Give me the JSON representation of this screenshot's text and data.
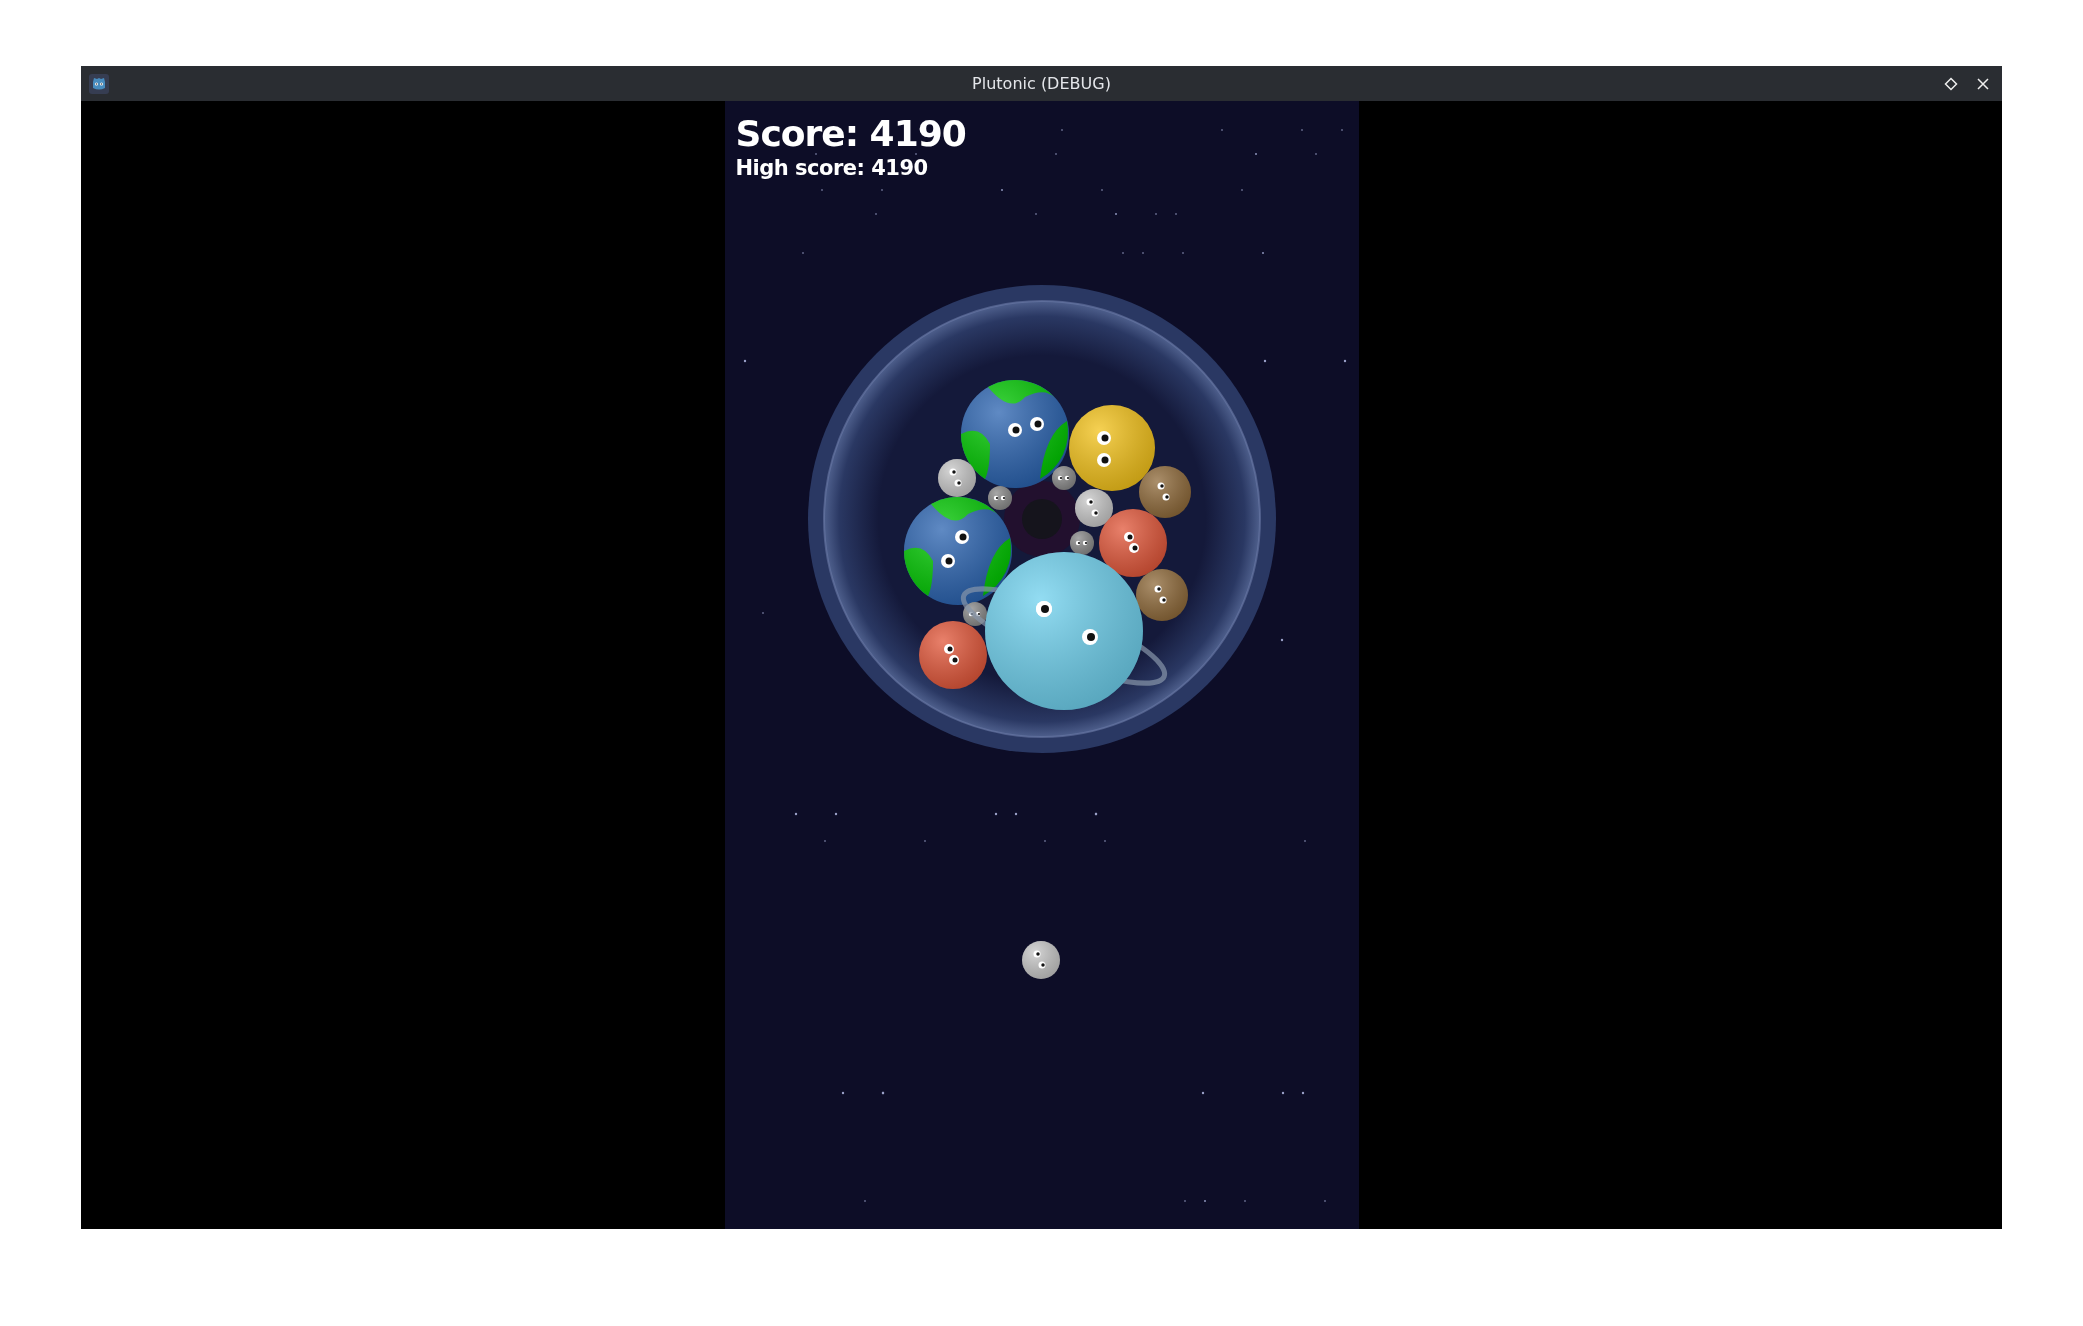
{
  "window": {
    "title": "Plutonic (DEBUG)"
  },
  "hud": {
    "score": "Score: 4190",
    "high_score": "High score: 4190"
  }
}
